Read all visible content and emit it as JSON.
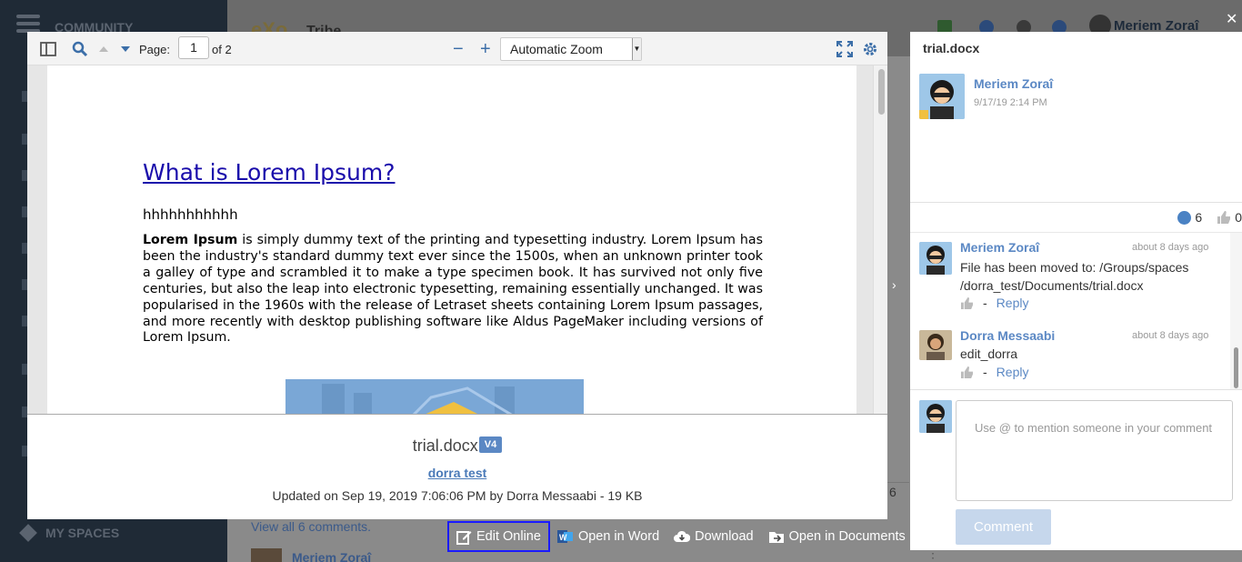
{
  "background": {
    "sidebar_title": "COMMUNITY",
    "sidebar_footer": "MY SPACES",
    "logo": "eXo",
    "app_title": "Tribe",
    "user_name": "Meriem Zoraî",
    "view_all": "View all 6 comments.",
    "comment_author": "Meriem Zoraî",
    "count": "6"
  },
  "viewer": {
    "toolbar": {
      "page_label": "Page:",
      "page_value": "1",
      "page_total": "of 2",
      "zoom": "Automatic Zoom",
      "zoom_out": "−",
      "zoom_in": "+"
    },
    "document": {
      "title": "What is Lorem Ipsum?",
      "heading": "hhhhhhhhhhh",
      "para_bold": "Lorem Ipsum",
      "para_text": " is simply dummy text of the printing and typesetting industry. Lorem Ipsum has been the industry's standard dummy text ever since the 1500s, when an unknown printer took a galley of type and scrambled it to make a type specimen book. It has survived not only five centuries, but also the leap into electronic typesetting, remaining essentially unchanged. It was popularised in the 1960s with the release of Letraset sheets containing Lorem Ipsum passages, and more recently with desktop publishing software like Aldus PageMaker including versions of Lorem Ipsum."
    },
    "meta": {
      "file_name": "trial.docx",
      "version": "V4",
      "space": "dorra test",
      "updated": "Updated on Sep 19, 2019 7:06:06 PM by Dorra Messaabi - 19 KB"
    }
  },
  "actions": {
    "edit_online": "Edit Online",
    "open_in_word": "Open in Word",
    "download": "Download",
    "open_in_documents": "Open in Documents"
  },
  "panel": {
    "title": "trial.docx",
    "author": "Meriem Zoraî",
    "date": "9/17/19 2:14 PM",
    "comment_count": "6",
    "like_count": "0",
    "comments": [
      {
        "name": "Meriem Zoraî",
        "time": "about 8 days ago",
        "text": "File has been moved to: /Groups/spaces /dorra_test/Documents/trial.docx",
        "sep": "-",
        "reply": "Reply"
      },
      {
        "name": "Dorra Messaabi",
        "time": "about 8 days ago",
        "text": "edit_dorra",
        "sep": "-",
        "reply": "Reply"
      }
    ],
    "input_placeholder": "Use @ to mention someone in your comment",
    "submit": "Comment"
  },
  "colors": {
    "accent": "#5b88c4",
    "link": "#1a0dab",
    "focus_outline": "#1a1aff",
    "overlay_sidebar": "#1f2a36"
  },
  "icons": [
    "sidebar-toggle-icon",
    "search-icon",
    "arrow-up-icon",
    "arrow-down-icon",
    "fullscreen-icon",
    "settings-icon",
    "edit-icon",
    "word-icon",
    "cloud-download-icon",
    "open-documents-icon",
    "comment-bubble-icon",
    "thumbs-up-icon",
    "close-icon",
    "chevron-right-icon"
  ]
}
